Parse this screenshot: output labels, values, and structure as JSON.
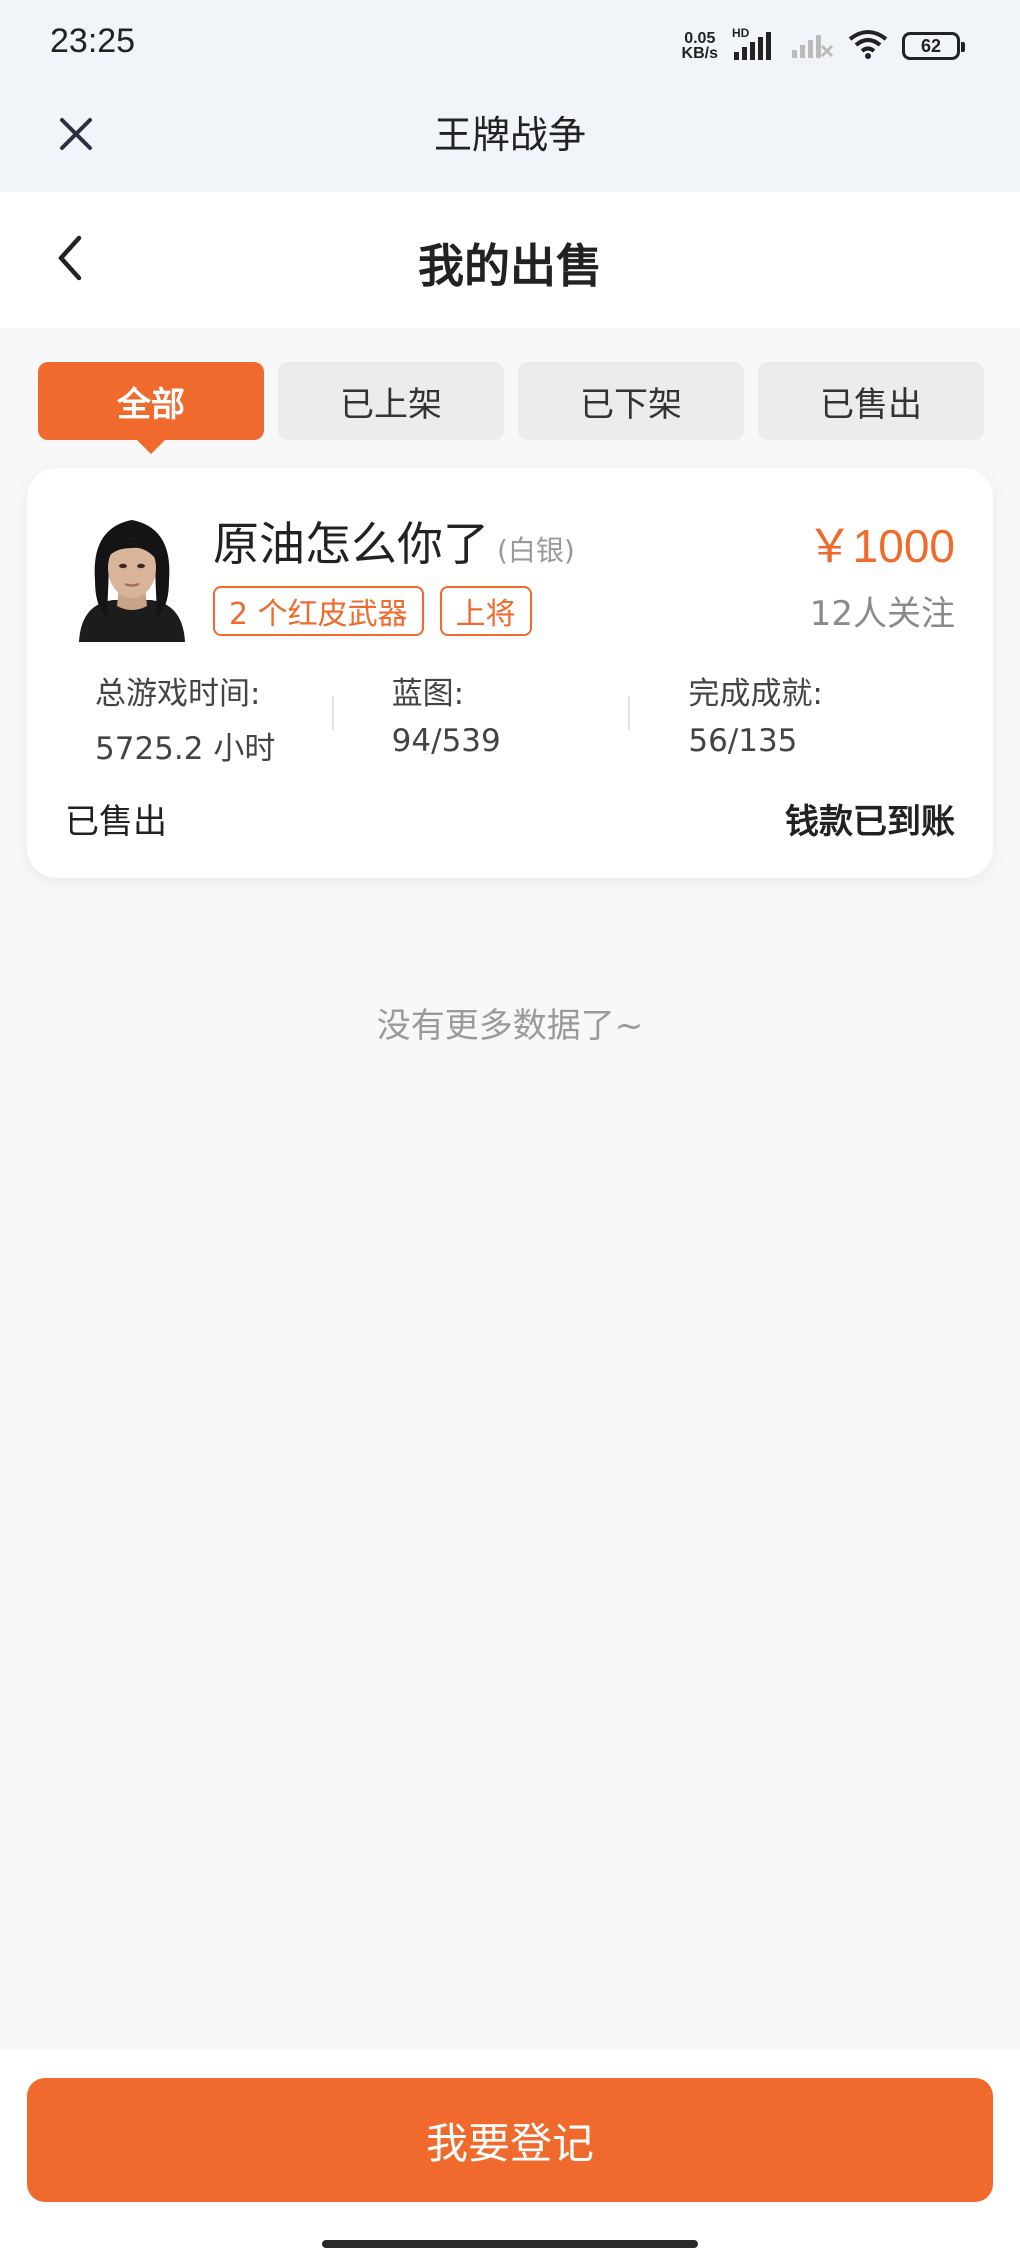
{
  "status_bar": {
    "time": "23:25",
    "net_speed_value": "0.05",
    "net_speed_unit": "KB/s",
    "network_label": "HD",
    "battery": "62"
  },
  "app_header": {
    "title": "王牌战争",
    "close_icon": "close-icon"
  },
  "page_nav": {
    "title": "我的出售",
    "back_icon": "chevron-left-icon"
  },
  "tabs": [
    {
      "label": "全部",
      "active": true
    },
    {
      "label": "已上架",
      "active": false
    },
    {
      "label": "已下架",
      "active": false
    },
    {
      "label": "已售出",
      "active": false
    }
  ],
  "listing": {
    "name": "原油怎么你了",
    "rank": "(白银)",
    "price": "￥1000",
    "followers": "12人关注",
    "tags": [
      "2 个红皮武器",
      "上将"
    ],
    "stats": [
      {
        "label": "总游戏时间:",
        "value": "5725.2 小时"
      },
      {
        "label": "蓝图:",
        "value": "94/539"
      },
      {
        "label": "完成成就:",
        "value": "56/135"
      }
    ],
    "sale_status": "已售出",
    "payment_status": "钱款已到账"
  },
  "footer_note": "没有更多数据了~",
  "bottom": {
    "register_label": "我要登记"
  },
  "colors": {
    "accent": "#ef6a2c",
    "header_bg": "#f1f4f8",
    "page_bg": "#f8f8f8"
  }
}
